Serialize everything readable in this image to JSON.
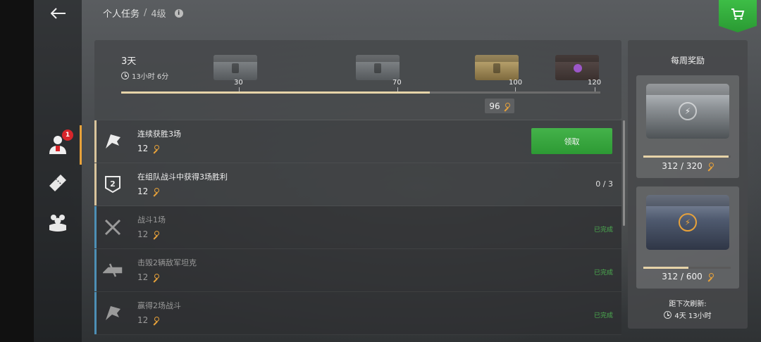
{
  "header": {
    "title": "个人任务",
    "separator": "/",
    "level": "4级"
  },
  "progress": {
    "days": "3天",
    "timer": "13小时 6分",
    "current_points": "96",
    "max_points": 120,
    "milestones": [
      {
        "value": "30",
        "chest": "gray"
      },
      {
        "value": "70",
        "chest": "gray"
      },
      {
        "value": "100",
        "chest": "gold"
      },
      {
        "value": "120",
        "chest": "dark"
      }
    ]
  },
  "tasks": [
    {
      "name": "连续获胜3场",
      "reward": "12",
      "status": "领取",
      "state": "claimable",
      "icon": "flag-icon"
    },
    {
      "name": "在组队战斗中获得3场胜利",
      "reward": "12",
      "status": "0 / 3",
      "state": "in-progress",
      "icon": "platoon-2-icon"
    },
    {
      "name": "战斗1场",
      "reward": "12",
      "status": "已完成",
      "state": "done",
      "icon": "crossed-swords-icon"
    },
    {
      "name": "击毁2辆敌军坦克",
      "reward": "12",
      "status": "已完成",
      "state": "done",
      "icon": "tank-destroyed-icon"
    },
    {
      "name": "赢得2场战斗",
      "reward": "12",
      "status": "已完成",
      "state": "done",
      "icon": "victory-flag-icon"
    }
  ],
  "weekly": {
    "title": "每周奖励",
    "rewards": [
      {
        "current": "312",
        "total": "320",
        "label": "312 / 320",
        "fraction": 0.975
      },
      {
        "current": "312",
        "total": "600",
        "label": "312 / 600",
        "fraction": 0.52
      }
    ],
    "refresh_label": "距下次刷新:",
    "refresh_time": "4天 13小时"
  },
  "sidebar": {
    "badge": "1",
    "items": [
      "personal-missions-icon",
      "ticket-icon",
      "clan-icon"
    ]
  },
  "colors": {
    "accent_gold": "#e8a23a",
    "claim_green": "#2d9a34",
    "done_blue": "#4d8fb5",
    "done_text_green": "#4caf50",
    "badge_red": "#d7262b"
  }
}
